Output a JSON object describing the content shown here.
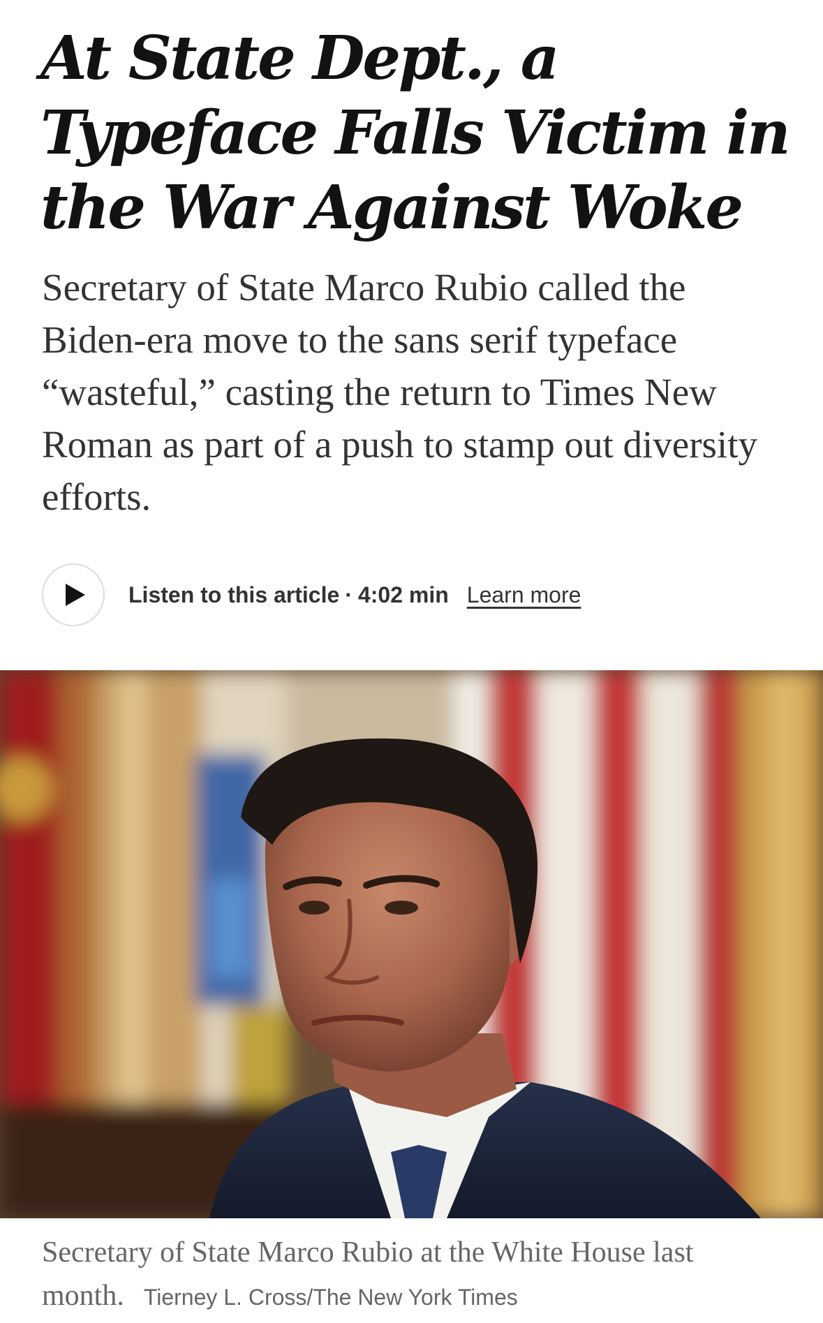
{
  "article": {
    "headline": "At State Dept., a Typeface Falls Victim in the War Against Woke",
    "summary": "Secretary of State Marco Rubio called the Biden-era move to the sans serif typeface “wasteful,” casting the return to Times New Roman as part of a push to stamp out diversity efforts."
  },
  "audio": {
    "play_icon": "play-icon",
    "listen_label": "Listen to this article",
    "separator": "·",
    "duration": "4:02 min",
    "learn_more": "Learn more"
  },
  "photo": {
    "caption": "Secretary of State Marco Rubio at the White House last month.",
    "credit": "Tierney L. Cross/The New York Times"
  },
  "colors": {
    "text": "#121212",
    "summary": "#333333",
    "caption": "#666666",
    "border": "#dcdcdc"
  }
}
